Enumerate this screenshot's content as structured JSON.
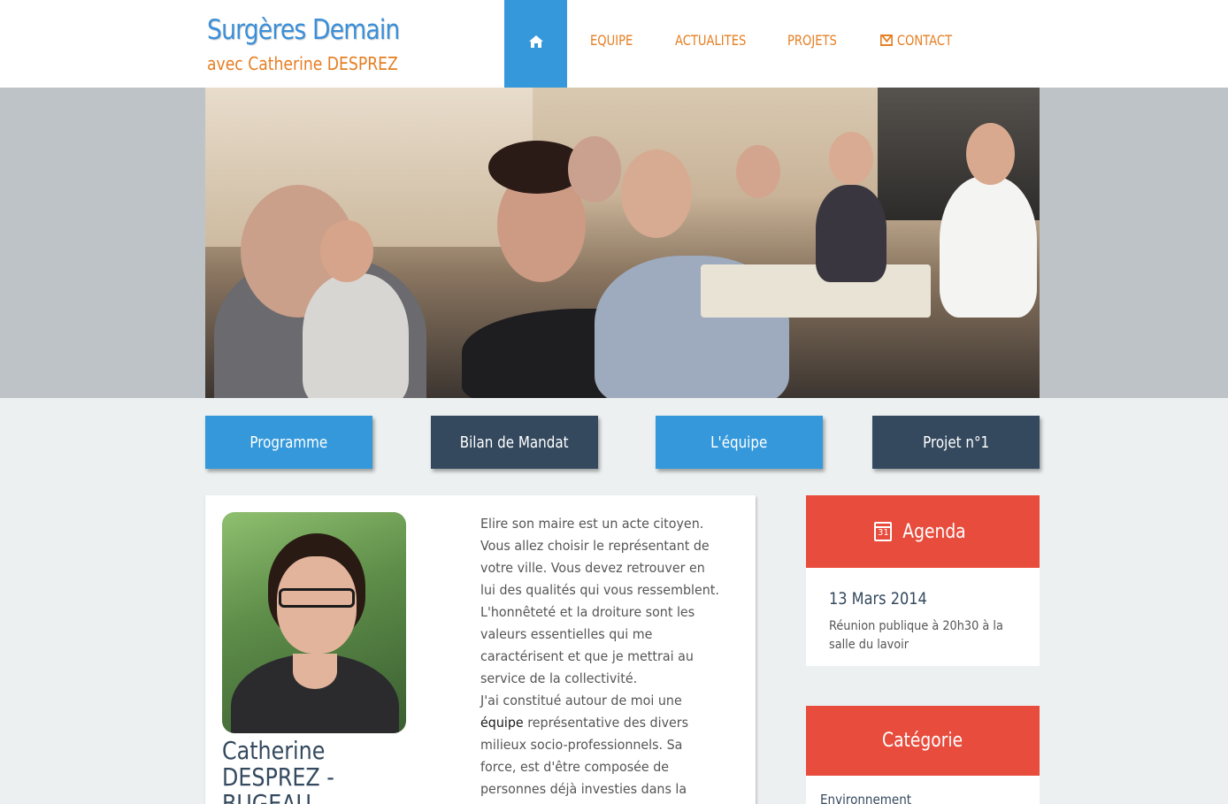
{
  "header": {
    "title": "Surgères Demain",
    "subtitle": "avec Catherine DESPREZ"
  },
  "nav": {
    "home_icon": "home-icon",
    "items": [
      {
        "label": "EQUIPE"
      },
      {
        "label": "ACTUALITES"
      },
      {
        "label": "PROJETS"
      },
      {
        "label": "CONTACT",
        "icon": "envelope-icon"
      }
    ]
  },
  "quick_links": [
    {
      "label": "Programme",
      "color": "#3498db"
    },
    {
      "label": "Bilan de Mandat",
      "color": "#34495e"
    },
    {
      "label": "L'équipe",
      "color": "#3498db"
    },
    {
      "label": "Projet n°1",
      "color": "#34495e"
    }
  ],
  "profile": {
    "name": "Catherine DESPREZ - BUGEAU",
    "intro_before_link": "Elire son maire est un acte citoyen. Vous allez choisir le représentant de votre ville. Vous devez retrouver en lui des qualités qui vous ressemblent. L'honnêteté et la droiture sont les valeurs essentielles qui me caractérisent et que je mettrai au service de la collectivité.",
    "intro_line2_start": "J'ai constitué autour de moi une",
    "intro_link": "équipe",
    "intro_after_link": "représentative des divers milieux socio-professionnels. Sa force, est d'être composée de personnes déjà investies dans la commune. Certaines font partie"
  },
  "agenda": {
    "title": "Agenda",
    "icon": "calendar-icon",
    "date": "13 Mars 2014",
    "text": "Réunion publique à 20h30 à la salle du lavoir"
  },
  "category": {
    "title": "Catégorie",
    "items": [
      {
        "label": "Environnement"
      }
    ]
  },
  "colors": {
    "primary": "#3498db",
    "dark": "#34495e",
    "accent": "#e67e22",
    "sidebar_red": "#e74c3c"
  }
}
